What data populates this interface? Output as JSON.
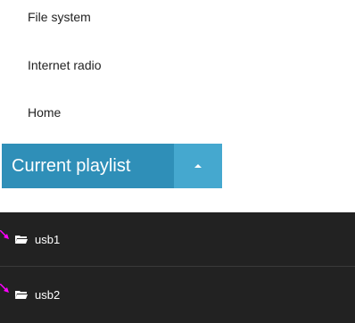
{
  "menu": {
    "items": [
      {
        "label": "File system"
      },
      {
        "label": "Internet radio"
      },
      {
        "label": "Home"
      }
    ]
  },
  "playlist": {
    "label": "Current playlist",
    "accent_color": "#2f8fb8",
    "caret_color": "#45a8cf",
    "caret_icon": "caret-up-icon"
  },
  "folders": [
    {
      "label": "usb1",
      "icon": "folder-open-icon"
    },
    {
      "label": "usb2",
      "icon": "folder-open-icon"
    }
  ],
  "colors": {
    "panel_bg": "#222222",
    "arrow_marker": "#ff00ff"
  }
}
